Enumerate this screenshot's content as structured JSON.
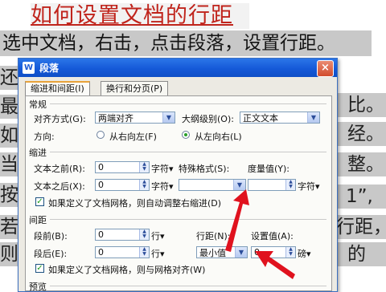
{
  "document": {
    "title": "如何设置文档的行距",
    "line1": "选中文档，右击，点击段落，设置行距。",
    "left_fragments": [
      "还",
      "最",
      "如",
      "当",
      "按",
      "若是",
      "则按"
    ],
    "right_fragments": [
      "比。",
      "经。",
      "整。",
      "1”,",
      "行距，",
      "的"
    ]
  },
  "dialog": {
    "title": "段落",
    "app_icon": "W",
    "close_label": "×",
    "tabs": [
      "缩进和间距(I)",
      "换行和分页(P)"
    ],
    "general": {
      "heading": "常规",
      "align_label": "对齐方式(G):",
      "align_value": "两端对齐",
      "outline_label": "大纲级别(O):",
      "outline_value": "正文文本",
      "direction_label": "方向:",
      "rtl_label": "从右向左(F)",
      "ltr_label": "从左向右(L)",
      "direction_selected": "ltr"
    },
    "indent": {
      "heading": "缩进",
      "before_label": "文本之前(R):",
      "before_value": "0",
      "after_label": "文本之后(X):",
      "after_value": "0",
      "unit": "字符▾",
      "special_label": "特殊格式(S):",
      "special_value": "",
      "measure_label": "度量值(Y):",
      "measure_value": "",
      "measure_unit": "字符▾",
      "grid_check_label": "如果定义了文档网格，则自动调整右缩进(D)",
      "grid_checked": true
    },
    "spacing": {
      "heading": "间距",
      "before_label": "段前(B):",
      "before_value": "0",
      "after_label": "段后(E):",
      "after_value": "0",
      "unit": "行▾",
      "line_label": "行距(N):",
      "line_value": "最小值",
      "setting_label": "设置值(A):",
      "setting_value": "0",
      "setting_unit": "磅▾",
      "grid_check_label": "如果定义了文档网格，则与网格对齐(W)",
      "grid_checked": true
    },
    "preview_heading": "预览"
  },
  "colors": {
    "title_red": "#c0241c",
    "arrow_red": "#e0121e",
    "titlebar_blue": "#1559d8"
  }
}
